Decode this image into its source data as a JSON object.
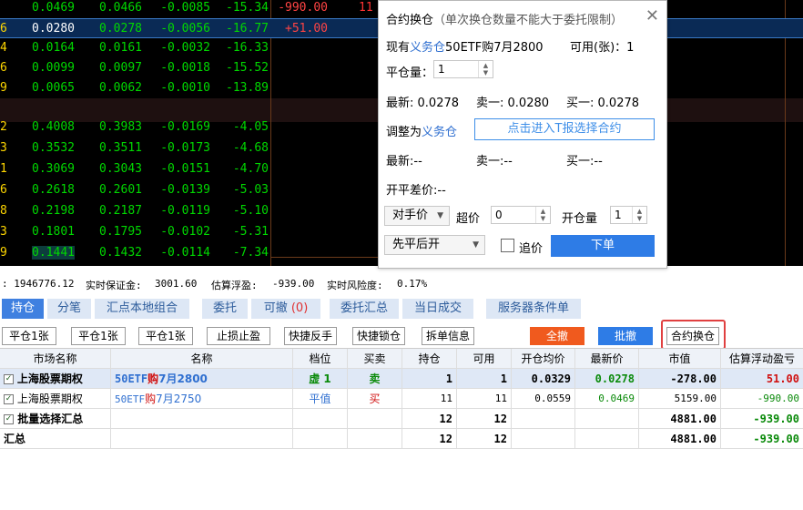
{
  "quote_rows_top": [
    {
      "idx": "",
      "c1": "0.0469",
      "c2": "0.0466",
      "c3": "-0.0085",
      "c4": "-15.34",
      "c5": "-990.00",
      "c6": "11",
      "selected": false
    },
    {
      "idx": "6",
      "c1": "0.0280",
      "c2": "0.0278",
      "c3": "-0.0056",
      "c4": "-16.77",
      "c5": "+51.00",
      "c6": "",
      "selected": true
    },
    {
      "idx": "4",
      "c1": "0.0164",
      "c2": "0.0161",
      "c3": "-0.0032",
      "c4": "-16.33",
      "c5": "",
      "c6": "",
      "selected": false
    },
    {
      "idx": "6",
      "c1": "0.0099",
      "c2": "0.0097",
      "c3": "-0.0018",
      "c4": "-15.52",
      "c5": "",
      "c6": "",
      "selected": false
    },
    {
      "idx": "9",
      "c1": "0.0065",
      "c2": "0.0062",
      "c3": "-0.0010",
      "c4": "-13.89",
      "c5": "",
      "c6": "",
      "selected": false
    }
  ],
  "quote_rows_bottom": [
    {
      "idx": "2",
      "c1": "0.4008",
      "c2": "0.3983",
      "c3": "-0.0169",
      "c4": "-4.05"
    },
    {
      "idx": "3",
      "c1": "0.3532",
      "c2": "0.3511",
      "c3": "-0.0173",
      "c4": "-4.68"
    },
    {
      "idx": "1",
      "c1": "0.3069",
      "c2": "0.3043",
      "c3": "-0.0151",
      "c4": "-4.70"
    },
    {
      "idx": "6",
      "c1": "0.2618",
      "c2": "0.2601",
      "c3": "-0.0139",
      "c4": "-5.03"
    },
    {
      "idx": "8",
      "c1": "0.2198",
      "c2": "0.2187",
      "c3": "-0.0119",
      "c4": "-5.10"
    },
    {
      "idx": "3",
      "c1": "0.1801",
      "c2": "0.1795",
      "c3": "-0.0102",
      "c4": "-5.31"
    },
    {
      "idx": "9",
      "c1": "0.1441",
      "c2": "0.1432",
      "c3": "-0.0114",
      "c4": "-7.34"
    }
  ],
  "dialog": {
    "title": "合约换仓",
    "title_note": "（单次换仓数量不能大于委托限制）",
    "current_prefix": "现有",
    "current_type": "义务仓",
    "current_contract": "50ETF购7月2800",
    "available_label": "可用(张)：",
    "available_value": "1",
    "close_qty_label": "平仓量：",
    "close_qty_value": "1",
    "latest_label": "最新:",
    "latest_value": "0.0278",
    "sell1_label": "卖一:",
    "sell1_value": "0.0280",
    "buy1_label": "买一:",
    "buy1_value": "0.0278",
    "adjust_label": "调整为",
    "adjust_type": "义务仓",
    "select_contract_btn": "点击进入T报选择合约",
    "latest2_label": "最新:",
    "latest2_value": "--",
    "sell2_label": "卖一:",
    "sell2_value": "--",
    "buy2_label": "买一:",
    "buy2_value": "--",
    "spread_label": "开平差价:",
    "spread_value": "--",
    "price_type": "对手价",
    "over_price_label": "超价",
    "over_price_value": "0",
    "open_qty_label": "开仓量",
    "open_qty_value": "1",
    "order_mode": "先平后开",
    "chase_label": "追价",
    "order_btn": "下单"
  },
  "status": {
    "balance": ": 1946776.12",
    "margin_label": "实时保证金:",
    "margin_value": "3001.60",
    "float_label": "估算浮盈:",
    "float_value": "-939.00",
    "risk_label": "实时风险度:",
    "risk_value": "0.17%"
  },
  "tabs": [
    {
      "label": "持仓",
      "count": ""
    },
    {
      "label": "分笔",
      "count": ""
    },
    {
      "label": "汇点本地组合",
      "count": ""
    },
    {
      "label": "委托",
      "count": ""
    },
    {
      "label": "可撤",
      "count": "(0)"
    },
    {
      "label": "委托汇总",
      "count": ""
    },
    {
      "label": "当日成交",
      "count": ""
    },
    {
      "label": "服务器条件单",
      "count": ""
    }
  ],
  "actions": {
    "close1_a": "平仓1张",
    "close1_b": "平仓1张",
    "close1_c": "平仓1张",
    "stop": "止损止盈",
    "quick_reverse": "快捷反手",
    "quick_lock": "快捷锁仓",
    "split_info": "拆单信息",
    "cancel_all": "全撤",
    "batch_cancel": "批撤",
    "switch_contract": "合约换仓"
  },
  "table": {
    "headers": [
      "市场名称",
      "名称",
      "档位",
      "买卖",
      "持仓",
      "可用",
      "开仓均价",
      "最新价",
      "市值",
      "估算浮动盈亏"
    ],
    "rows": [
      {
        "market": "上海股票期权",
        "name_a": "50ETF",
        "name_b": "购",
        "name_c": "7月2800",
        "level": "虚 1",
        "side": "卖",
        "hold": "1",
        "avail": "1",
        "avg": "0.0329",
        "last": "0.0278",
        "value": "-278.00",
        "pnl": "51.00"
      },
      {
        "market": "上海股票期权",
        "name_a": "50ETF",
        "name_b": "购",
        "name_c": "7月2750",
        "level": "平值",
        "side": "买",
        "hold": "11",
        "avail": "11",
        "avg": "0.0559",
        "last": "0.0469",
        "value": "5159.00",
        "pnl": "-990.00"
      }
    ],
    "batch_label": "批量选择汇总",
    "batch_hold": "12",
    "batch_avail": "12",
    "batch_value": "4881.00",
    "batch_pnl": "-939.00",
    "total_label": "汇总",
    "total_hold": "12",
    "total_avail": "12",
    "total_value": "4881.00",
    "total_pnl": "-939.00"
  }
}
